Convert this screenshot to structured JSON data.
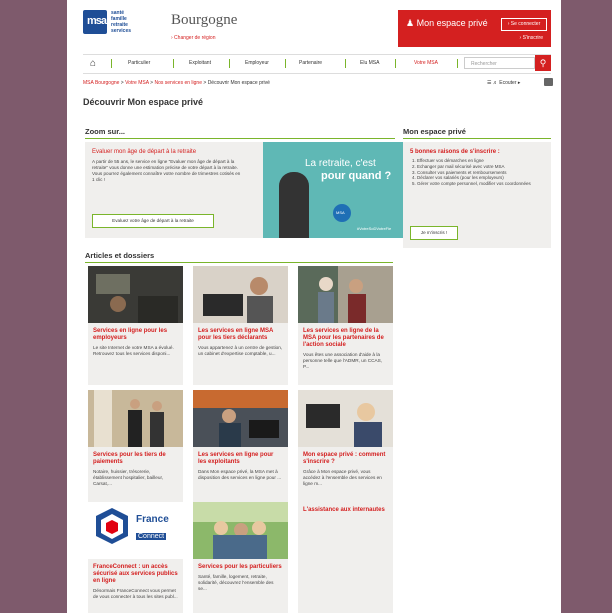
{
  "header": {
    "logo_text": "msa",
    "logo_tagline": [
      "santé",
      "famille",
      "retraite",
      "services"
    ],
    "region": "Bourgogne",
    "change_region": "› Changer de région",
    "espace_title": "Mon espace privé",
    "connect_label": "› Se connecter",
    "register_label": "› S'inscrire"
  },
  "nav": {
    "home_icon": "home-icon",
    "items": [
      "Particulier",
      "Exploitant",
      "Employeur",
      "Partenaire",
      "Elu MSA",
      "Votre MSA"
    ],
    "search_placeholder": "Rechercher",
    "accent": "#7ab52b"
  },
  "breadcrumb": [
    "MSA Bourgogne",
    "Votre MSA",
    "Nos services en ligne",
    "Découvrir Mon espace privé"
  ],
  "tools": {
    "listen_label": "Ecouter"
  },
  "page_title": "Découvrir Mon espace privé",
  "zoom": {
    "section_title": "Zoom sur...",
    "title": "Evaluer mon âge de départ à la retraite",
    "text": "A partir de 55 ans, le service en ligne \"Evaluer mon âge de départ à la retraite\" vous donne une estimation précise de votre départ à la retraite. Vous pourrez également connaître votre nombre de trimestres cotisés en 1 clic !",
    "button": "Evaluez votre âge de départ à la retraite",
    "image_line1": "La retraite, c'est",
    "image_line2": "pour quand ?",
    "image_badge": "MSA",
    "image_tag": "#VotreSoDVotreFie"
  },
  "espace": {
    "section_title": "Mon espace privé",
    "title": "5 bonnes raisons de s'inscrire :",
    "reasons": [
      "Effectuer vos démarches en ligne",
      "Echanger par mail sécurisé avec votre MSA",
      "Consulter vos paiements et remboursements",
      "Déclarer vos salariés (pour les employeurs)",
      "Gérer votre compte personnel, modifier vos coordonnées"
    ],
    "button": "Je m'inscris !"
  },
  "articles": {
    "section_title": "Articles et dossiers",
    "cards": [
      {
        "title": "Services en ligne pour les employeurs",
        "text": "Le site Internet de votre MSA a évolué. Retrouvez tous les services disponi..."
      },
      {
        "title": "Les services en ligne MSA pour les tiers déclarants",
        "text": "Vous appartenez à un centre de gestion, un cabinet d'expertise comptable, u..."
      },
      {
        "title": "Les services en ligne de la MSA pour les partenaires de l'action sociale",
        "text": "Vous êtes une association d'aide à la personne telle que l'ADMR, un CCAS, P..."
      },
      {
        "title": "Services pour les tiers de paiements",
        "text": "Notaire, huissier, trésorerie, établissement hospitalier, bailleur, Carsat,..."
      },
      {
        "title": "Les services en ligne pour les exploitants",
        "text": "Dans Mon espace privé, la MSA met à disposition des services en ligne pour ..."
      },
      {
        "title": "Mon espace privé : comment s'inscrire ?",
        "text": "Grâce à Mon espace privé, vous accédez à l'ensemble des services en ligne m..."
      },
      {
        "title": "FranceConnect : un accès sécurisé aux services publics en ligne",
        "text": "Désormais FranceConnect vous permet de vous connecter à tous les sites publ..."
      },
      {
        "title": "Services pour les particuliers",
        "text": "Santé, famille, logement, retraite, solidarité, découvrez l'ensemble des se..."
      },
      {
        "title": "L'assistance aux internautes",
        "text": ""
      }
    ],
    "franceconnect_logo": [
      "France",
      "Connect"
    ]
  },
  "colors": {
    "red": "#d42020",
    "green": "#7ab52b",
    "panel": "#f0efed",
    "frame": "#7e5a6c"
  }
}
